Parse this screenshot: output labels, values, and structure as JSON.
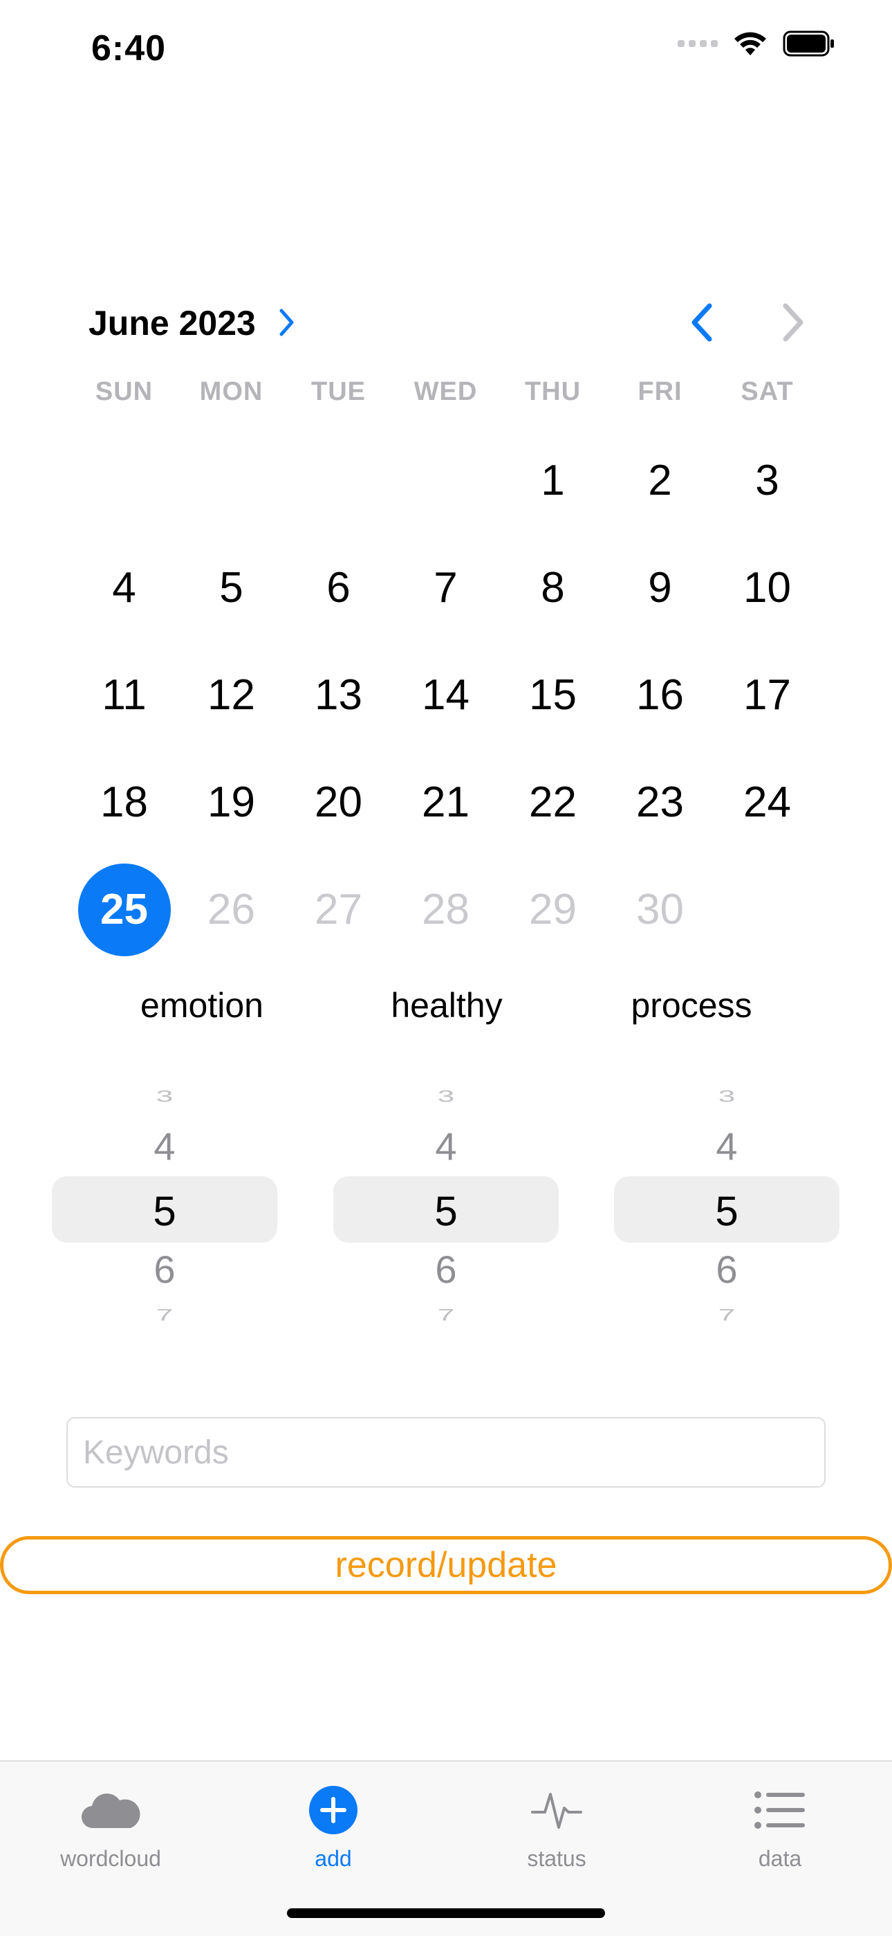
{
  "status_bar": {
    "time": "6:40"
  },
  "calendar": {
    "month_label": "June 2023",
    "weekdays": [
      "SUN",
      "MON",
      "TUE",
      "WED",
      "THU",
      "FRI",
      "SAT"
    ],
    "days": [
      "",
      "",
      "",
      "",
      "1",
      "2",
      "3",
      "4",
      "5",
      "6",
      "7",
      "8",
      "9",
      "10",
      "11",
      "12",
      "13",
      "14",
      "15",
      "16",
      "17",
      "18",
      "19",
      "20",
      "21",
      "22",
      "23",
      "24",
      "25",
      "26",
      "27",
      "28",
      "29",
      "30",
      ""
    ],
    "selected_day": "25",
    "disabled_days": [
      "26",
      "27",
      "28",
      "29",
      "30"
    ],
    "accent": "#0a7af6"
  },
  "pickers": [
    {
      "label": "emotion",
      "values": [
        "3",
        "4",
        "5",
        "6",
        "7"
      ],
      "selected": "5"
    },
    {
      "label": "healthy",
      "values": [
        "3",
        "4",
        "5",
        "6",
        "7"
      ],
      "selected": "5"
    },
    {
      "label": "process",
      "values": [
        "3",
        "4",
        "5",
        "6",
        "7"
      ],
      "selected": "5"
    }
  ],
  "keywords": {
    "placeholder": "Keywords",
    "value": ""
  },
  "record_button": {
    "label": "record/update",
    "color": "#f59a12"
  },
  "tabs": [
    {
      "label": "wordcloud",
      "icon": "cloud-icon",
      "active": false
    },
    {
      "label": "add",
      "icon": "plus-circle-icon",
      "active": true
    },
    {
      "label": "status",
      "icon": "waveform-icon",
      "active": false
    },
    {
      "label": "data",
      "icon": "list-icon",
      "active": false
    }
  ]
}
